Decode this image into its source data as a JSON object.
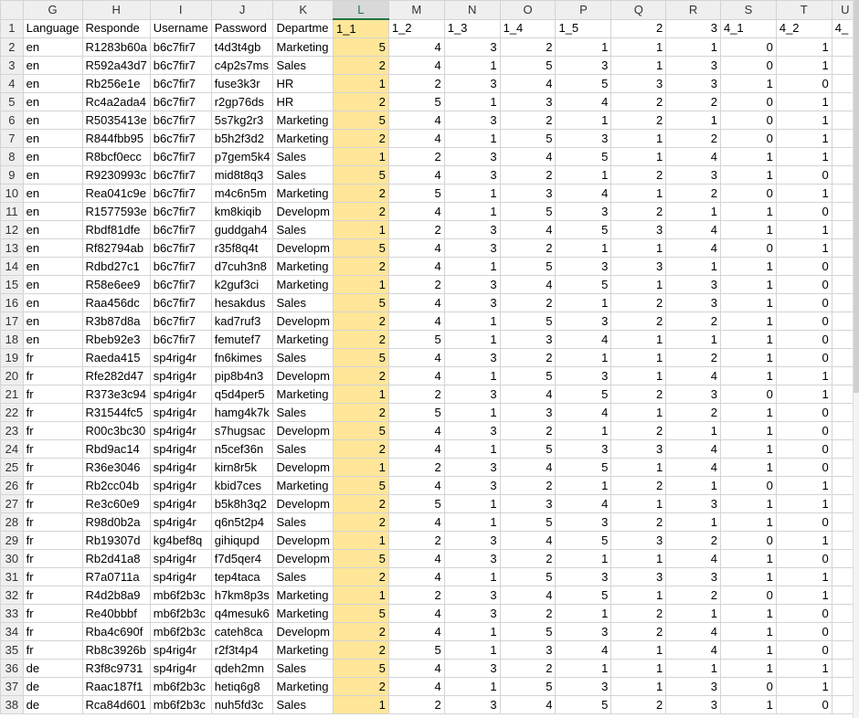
{
  "columns": [
    "G",
    "H",
    "I",
    "J",
    "K",
    "L",
    "M",
    "N",
    "O",
    "P",
    "Q",
    "R",
    "S",
    "T",
    "U"
  ],
  "selected_column": "L",
  "highlight_color": "#ffe699",
  "header_row": [
    "Language",
    "Responde",
    "Username",
    "Password",
    "Departme",
    "1_1",
    "1_2",
    "1_3",
    "1_4",
    "1_5",
    "2",
    "3",
    "4_1",
    "4_2",
    "4_"
  ],
  "rows": [
    {
      "n": "2",
      "c": [
        "en",
        "R1283b60a",
        "b6c7fir7",
        "t4d3t4gb",
        "Marketing",
        "5",
        "4",
        "3",
        "2",
        "1",
        "1",
        "1",
        "0",
        "1"
      ]
    },
    {
      "n": "3",
      "c": [
        "en",
        "R592a43d7",
        "b6c7fir7",
        "c4p2s7ms",
        "Sales",
        "2",
        "4",
        "1",
        "5",
        "3",
        "1",
        "3",
        "0",
        "1"
      ]
    },
    {
      "n": "4",
      "c": [
        "en",
        "Rb256e1e",
        "b6c7fir7",
        "fuse3k3r",
        "HR",
        "1",
        "2",
        "3",
        "4",
        "5",
        "3",
        "3",
        "1",
        "0"
      ]
    },
    {
      "n": "5",
      "c": [
        "en",
        "Rc4a2ada4",
        "b6c7fir7",
        "r2gp76ds",
        "HR",
        "2",
        "5",
        "1",
        "3",
        "4",
        "2",
        "2",
        "0",
        "1"
      ]
    },
    {
      "n": "6",
      "c": [
        "en",
        "R5035413e",
        "b6c7fir7",
        "5s7kg2r3",
        "Marketing",
        "5",
        "4",
        "3",
        "2",
        "1",
        "2",
        "1",
        "0",
        "1"
      ]
    },
    {
      "n": "7",
      "c": [
        "en",
        "R844fbb95",
        "b6c7fir7",
        "b5h2f3d2",
        "Marketing",
        "2",
        "4",
        "1",
        "5",
        "3",
        "1",
        "2",
        "0",
        "1"
      ]
    },
    {
      "n": "8",
      "c": [
        "en",
        "R8bcf0ecc",
        "b6c7fir7",
        "p7gem5k4",
        "Sales",
        "1",
        "2",
        "3",
        "4",
        "5",
        "1",
        "4",
        "1",
        "1"
      ]
    },
    {
      "n": "9",
      "c": [
        "en",
        "R9230993c",
        "b6c7fir7",
        "mid8t8q3",
        "Sales",
        "5",
        "4",
        "3",
        "2",
        "1",
        "2",
        "3",
        "1",
        "0"
      ]
    },
    {
      "n": "10",
      "c": [
        "en",
        "Rea041c9e",
        "b6c7fir7",
        "m4c6n5m",
        "Marketing",
        "2",
        "5",
        "1",
        "3",
        "4",
        "1",
        "2",
        "0",
        "1"
      ]
    },
    {
      "n": "11",
      "c": [
        "en",
        "R1577593e",
        "b6c7fir7",
        "km8kiqib",
        "Developm",
        "2",
        "4",
        "1",
        "5",
        "3",
        "2",
        "1",
        "1",
        "0"
      ]
    },
    {
      "n": "12",
      "c": [
        "en",
        "Rbdf81dfe",
        "b6c7fir7",
        "guddgah4",
        "Sales",
        "1",
        "2",
        "3",
        "4",
        "5",
        "3",
        "4",
        "1",
        "1"
      ]
    },
    {
      "n": "13",
      "c": [
        "en",
        "Rf82794ab",
        "b6c7fir7",
        "r35f8q4t",
        "Developm",
        "5",
        "4",
        "3",
        "2",
        "1",
        "1",
        "4",
        "0",
        "1"
      ]
    },
    {
      "n": "14",
      "c": [
        "en",
        "Rdbd27c1",
        "b6c7fir7",
        "d7cuh3n8",
        "Marketing",
        "2",
        "4",
        "1",
        "5",
        "3",
        "3",
        "1",
        "1",
        "0"
      ]
    },
    {
      "n": "15",
      "c": [
        "en",
        "R58e6ee9",
        "b6c7fir7",
        "k2guf3ci",
        "Marketing",
        "1",
        "2",
        "3",
        "4",
        "5",
        "1",
        "3",
        "1",
        "0"
      ]
    },
    {
      "n": "16",
      "c": [
        "en",
        "Raa456dc",
        "b6c7fir7",
        "hesakdus",
        "Sales",
        "5",
        "4",
        "3",
        "2",
        "1",
        "2",
        "3",
        "1",
        "0"
      ]
    },
    {
      "n": "17",
      "c": [
        "en",
        "R3b87d8a",
        "b6c7fir7",
        "kad7ruf3",
        "Developm",
        "2",
        "4",
        "1",
        "5",
        "3",
        "2",
        "2",
        "1",
        "0"
      ]
    },
    {
      "n": "18",
      "c": [
        "en",
        "Rbeb92e3",
        "b6c7fir7",
        "femutef7",
        "Marketing",
        "2",
        "5",
        "1",
        "3",
        "4",
        "1",
        "1",
        "1",
        "0"
      ]
    },
    {
      "n": "19",
      "c": [
        "fr",
        "Raeda415",
        "sp4rig4r",
        "fn6kimes",
        "Sales",
        "5",
        "4",
        "3",
        "2",
        "1",
        "1",
        "2",
        "1",
        "0"
      ]
    },
    {
      "n": "20",
      "c": [
        "fr",
        "Rfe282d47",
        "sp4rig4r",
        "pip8b4n3",
        "Developm",
        "2",
        "4",
        "1",
        "5",
        "3",
        "1",
        "4",
        "1",
        "1"
      ]
    },
    {
      "n": "21",
      "c": [
        "fr",
        "R373e3c94",
        "sp4rig4r",
        "q5d4per5",
        "Marketing",
        "1",
        "2",
        "3",
        "4",
        "5",
        "2",
        "3",
        "0",
        "1"
      ]
    },
    {
      "n": "22",
      "c": [
        "fr",
        "R31544fc5",
        "sp4rig4r",
        "hamg4k7k",
        "Sales",
        "2",
        "5",
        "1",
        "3",
        "4",
        "1",
        "2",
        "1",
        "0"
      ]
    },
    {
      "n": "23",
      "c": [
        "fr",
        "R00c3bc30",
        "sp4rig4r",
        "s7hugsac",
        "Developm",
        "5",
        "4",
        "3",
        "2",
        "1",
        "2",
        "1",
        "1",
        "0"
      ]
    },
    {
      "n": "24",
      "c": [
        "fr",
        "Rbd9ac14",
        "sp4rig4r",
        "n5cef36n",
        "Sales",
        "2",
        "4",
        "1",
        "5",
        "3",
        "3",
        "4",
        "1",
        "0"
      ]
    },
    {
      "n": "25",
      "c": [
        "fr",
        "R36e3046",
        "sp4rig4r",
        "kirn8r5k",
        "Developm",
        "1",
        "2",
        "3",
        "4",
        "5",
        "1",
        "4",
        "1",
        "0"
      ]
    },
    {
      "n": "26",
      "c": [
        "fr",
        "Rb2cc04b",
        "sp4rig4r",
        "kbid7ces",
        "Marketing",
        "5",
        "4",
        "3",
        "2",
        "1",
        "2",
        "1",
        "0",
        "1"
      ]
    },
    {
      "n": "27",
      "c": [
        "fr",
        "Re3c60e9",
        "sp4rig4r",
        "b5k8h3q2",
        "Developm",
        "2",
        "5",
        "1",
        "3",
        "4",
        "1",
        "3",
        "1",
        "1"
      ]
    },
    {
      "n": "28",
      "c": [
        "fr",
        "R98d0b2a",
        "sp4rig4r",
        "q6n5t2p4",
        "Sales",
        "2",
        "4",
        "1",
        "5",
        "3",
        "2",
        "1",
        "1",
        "0"
      ]
    },
    {
      "n": "29",
      "c": [
        "fr",
        "Rb19307d",
        "kg4bef8q",
        "gihiqupd",
        "Developm",
        "1",
        "2",
        "3",
        "4",
        "5",
        "3",
        "2",
        "0",
        "1"
      ]
    },
    {
      "n": "30",
      "c": [
        "fr",
        "Rb2d41a8",
        "sp4rig4r",
        "f7d5qer4",
        "Developm",
        "5",
        "4",
        "3",
        "2",
        "1",
        "1",
        "4",
        "1",
        "0"
      ]
    },
    {
      "n": "31",
      "c": [
        "fr",
        "R7a0711a",
        "sp4rig4r",
        "tep4taca",
        "Sales",
        "2",
        "4",
        "1",
        "5",
        "3",
        "3",
        "3",
        "1",
        "1"
      ]
    },
    {
      "n": "32",
      "c": [
        "fr",
        "R4d2b8a9",
        "mb6f2b3c",
        "h7km8p3s",
        "Marketing",
        "1",
        "2",
        "3",
        "4",
        "5",
        "1",
        "2",
        "0",
        "1"
      ]
    },
    {
      "n": "33",
      "c": [
        "fr",
        "Re40bbbf",
        "mb6f2b3c",
        "q4mesuk6",
        "Marketing",
        "5",
        "4",
        "3",
        "2",
        "1",
        "2",
        "1",
        "1",
        "0"
      ]
    },
    {
      "n": "34",
      "c": [
        "fr",
        "Rba4c690f",
        "mb6f2b3c",
        "cateh8ca",
        "Developm",
        "2",
        "4",
        "1",
        "5",
        "3",
        "2",
        "4",
        "1",
        "0"
      ]
    },
    {
      "n": "35",
      "c": [
        "fr",
        "Rb8c3926b",
        "sp4rig4r",
        "r2f3t4p4",
        "Marketing",
        "2",
        "5",
        "1",
        "3",
        "4",
        "1",
        "4",
        "1",
        "0"
      ]
    },
    {
      "n": "36",
      "c": [
        "de",
        "R3f8c9731",
        "sp4rig4r",
        "qdeh2mn",
        "Sales",
        "5",
        "4",
        "3",
        "2",
        "1",
        "1",
        "1",
        "1",
        "1"
      ]
    },
    {
      "n": "37",
      "c": [
        "de",
        "Raac187f1",
        "mb6f2b3c",
        "hetiq6g8",
        "Marketing",
        "2",
        "4",
        "1",
        "5",
        "3",
        "1",
        "3",
        "0",
        "1"
      ]
    },
    {
      "n": "38",
      "c": [
        "de",
        "Rca84d601",
        "mb6f2b3c",
        "nuh5fd3c",
        "Sales",
        "1",
        "2",
        "3",
        "4",
        "5",
        "2",
        "3",
        "1",
        "0"
      ]
    }
  ]
}
